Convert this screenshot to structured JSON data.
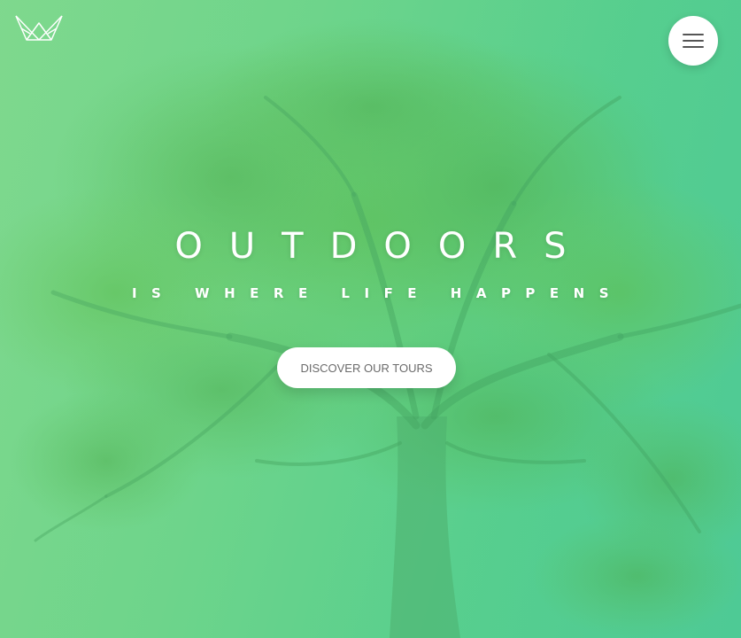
{
  "header": {
    "logo_icon": "crown-logo-icon",
    "menu_icon": "hamburger-menu-icon"
  },
  "hero": {
    "title": "OUTDOORS",
    "subtitle": "IS WHERE LIFE HAPPENS",
    "cta_label": "DISCOVER OUR TOURS",
    "background_image": "green-tinted-tree-photo"
  },
  "colors": {
    "gradient_start": "#7fd88e",
    "gradient_end": "#4fcb95",
    "text": "#ffffff",
    "button_bg": "#ffffff",
    "button_text": "#6b6b6b"
  }
}
